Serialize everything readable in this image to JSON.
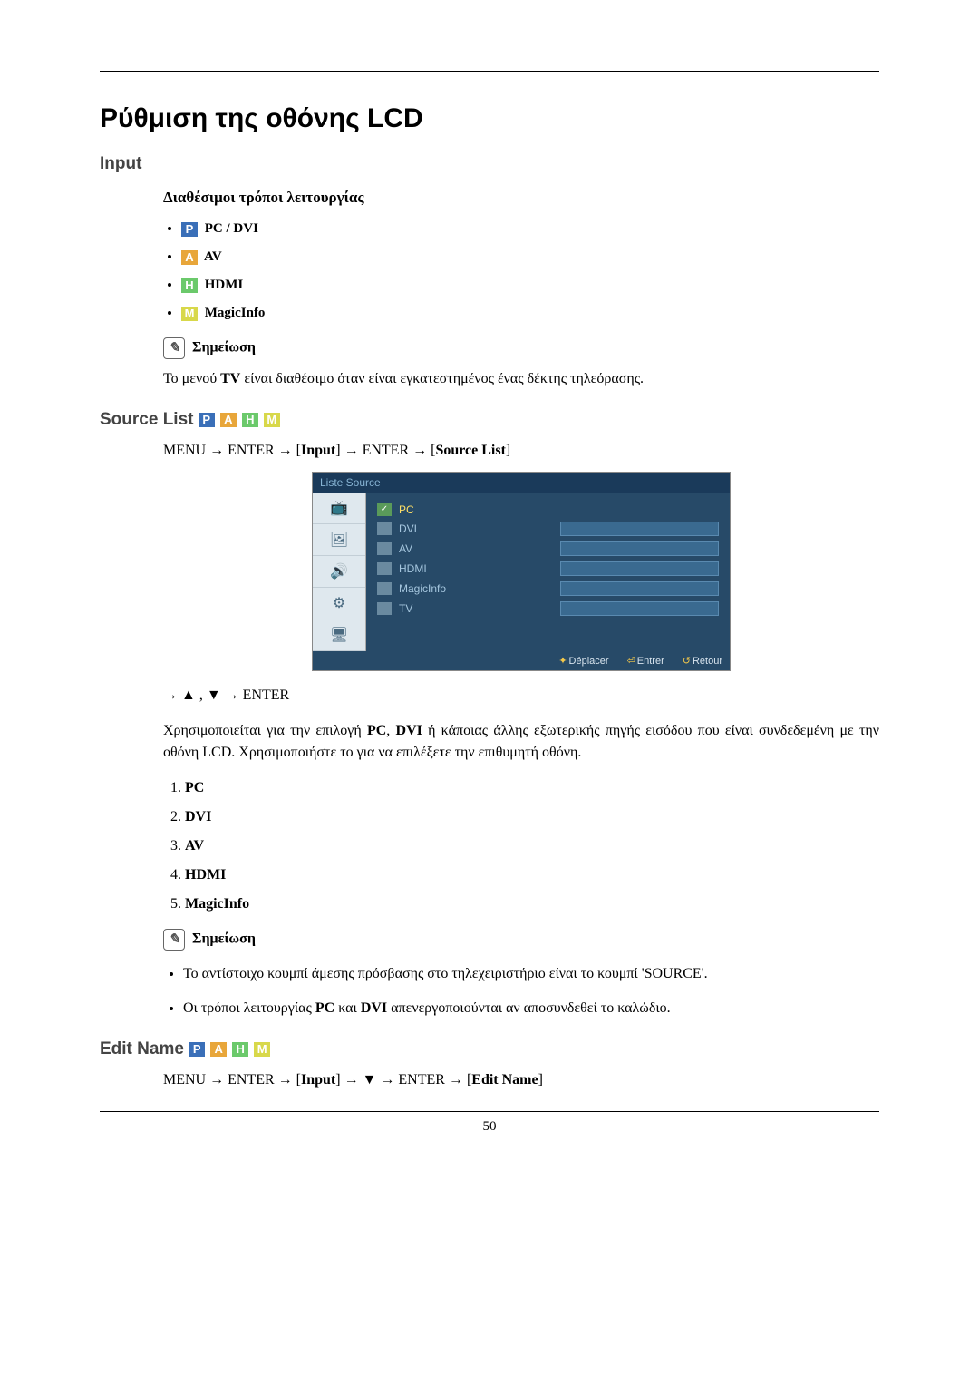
{
  "title": "Ρύθμιση της οθόνης LCD",
  "input": {
    "heading": "Input",
    "modesHeading": "Διαθέσιμοι τρόποι λειτουργίας",
    "modes": {
      "p": "PC / DVI",
      "a": "AV",
      "h": "HDMI",
      "m": "MagicInfo"
    },
    "note1Label": "Σημείωση",
    "note1Text": "Το μενού TV είναι διαθέσιμο όταν είναι εγκατεστημένος ένας δέκτης τηλεόρασης.",
    "noteBold": "TV"
  },
  "sourceList": {
    "heading": "Source List",
    "menuPath": {
      "p1": "MENU → ENTER → [",
      "b1": "Input",
      "p2": "] → ENTER → [",
      "b2": "Source List",
      "p3": "]"
    },
    "osd": {
      "title": "Liste Source",
      "items": {
        "pc": "PC",
        "dvi": "DVI",
        "av": "AV",
        "hdmi": "HDMI",
        "magicinfo": "MagicInfo",
        "tv": "TV"
      },
      "footer": {
        "move": "Déplacer",
        "enter": "Entrer",
        "return": "Retour"
      }
    },
    "navInstr": "→ ▲ , ▼ → ENTER",
    "desc": {
      "p1": "Χρησιμοποιείται για την επιλογή ",
      "b1": "PC",
      "p2": ", ",
      "b2": "DVI",
      "p3": " ή κάποιας άλλης εξωτερικής πηγής εισόδου που είναι συνδεδεμένη με την οθόνη LCD. Χρησιμοποιήστε το για να επιλέξετε την επιθυμητή οθόνη."
    },
    "list": {
      "i1": "PC",
      "i2": "DVI",
      "i3": "AV",
      "i4": "HDMI",
      "i5": "MagicInfo"
    },
    "note2Label": "Σημείωση",
    "note2_bullets": {
      "b1": "Το αντίστοιχο κουμπί άμεσης πρόσβασης στο τηλεχειριστήριο είναι το κουμπί 'SOURCE'.",
      "b2_p1": "Οι τρόποι λειτουργίας ",
      "b2_b1": "PC",
      "b2_p2": " και ",
      "b2_b2": "DVI",
      "b2_p3": " απενεργοποιούνται αν αποσυνδεθεί το καλώδιο."
    }
  },
  "editName": {
    "heading": "Edit Name",
    "menuPath": {
      "p1": "MENU → ENTER → [",
      "b1": "Input",
      "p2": "] → ▼ → ENTER → [",
      "b2": "Edit Name",
      "p3": "]"
    }
  },
  "pageNumber": "50"
}
